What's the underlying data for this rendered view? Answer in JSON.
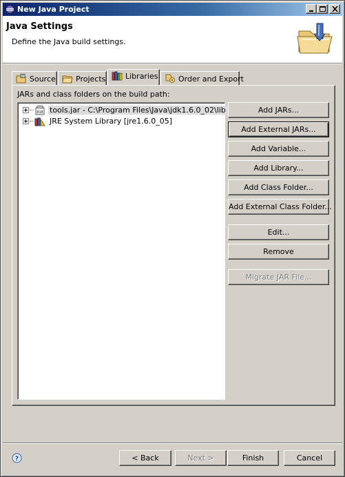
{
  "window": {
    "title": "New Java Project",
    "controls": {
      "minimize": "minimize-icon",
      "maximize": "maximize-icon",
      "close": "close-icon"
    }
  },
  "banner": {
    "title": "Java Settings",
    "subtitle": "Define the Java build settings.",
    "icon": "new-java-project-folder-icon"
  },
  "tabs": [
    {
      "label": "Source",
      "icon": "source-folder-icon",
      "active": false
    },
    {
      "label": "Projects",
      "icon": "projects-folder-icon",
      "active": false
    },
    {
      "label": "Libraries",
      "icon": "libraries-icon",
      "active": true
    },
    {
      "label": "Order and Export",
      "icon": "order-export-icon",
      "active": false
    }
  ],
  "libraries": {
    "heading": "JARs and class folders on the build path:",
    "entries": [
      {
        "label": "tools.jar - C:\\Program Files\\Java\\jdk1.6.0_02\\lib",
        "icon": "jar-icon",
        "selected": true
      },
      {
        "label": "JRE System Library [jre1.6.0_05]",
        "icon": "library-icon",
        "selected": false
      }
    ],
    "buttons": {
      "add_jars": "Add JARs...",
      "add_external_jars": "Add External JARs...",
      "add_variable": "Add Variable...",
      "add_library": "Add Library...",
      "add_class_folder": "Add Class Folder...",
      "add_external_class_folder": "Add External Class Folder...",
      "edit": "Edit...",
      "remove": "Remove",
      "migrate_jar": "Migrate JAR File..."
    }
  },
  "footer": {
    "help_icon": "help-icon",
    "back": "< Back",
    "next": "Next >",
    "finish": "Finish",
    "cancel": "Cancel"
  },
  "colors": {
    "dialog_bg": "#d4d0c8",
    "title_gradient_start": "#0a246a",
    "title_gradient_end": "#a6caf0"
  }
}
